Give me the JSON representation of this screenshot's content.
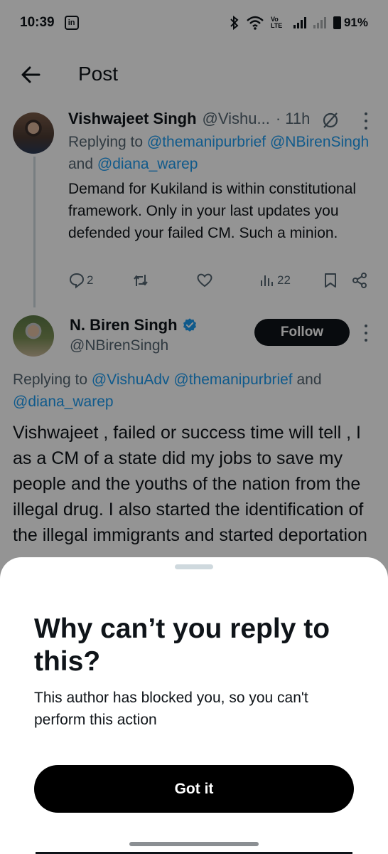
{
  "status_bar": {
    "time": "10:39",
    "app_badge": "in",
    "battery": "91%",
    "volte": "Vo LTE"
  },
  "header": {
    "title": "Post"
  },
  "tweet1": {
    "name": "Vishwajeet Singh",
    "handle": "@Vishu...",
    "time": "· 11h",
    "replying_prefix": "Replying to ",
    "replying_link1": "@themanipurbrief",
    "replying_link2": "@NBirenSingh",
    "replying_and": " and ",
    "replying_link3": "@diana_warep",
    "body": "Demand for Kukiland is within constitutional framework. Only in your last updates you defended your failed CM. Such a minion.",
    "replies": "2",
    "views": "22"
  },
  "tweet2": {
    "name": "N. Biren Singh",
    "handle": "@NBirenSingh",
    "follow_label": "Follow",
    "replying_prefix": "Replying to ",
    "replying_link1": "@VishuAdv",
    "replying_link2": "@themanipurbrief",
    "replying_and": " and ",
    "replying_link3": "@diana_warep",
    "body": "Vishwajeet , failed or success time will tell , I as a CM of a state did my jobs to save my people and the youths of the nation from the illegal drug. I also started the identification of the illegal immigrants and started deportation"
  },
  "sheet": {
    "title": "Why can’t you reply to this?",
    "text": "This author has blocked you, so you can't perform this action",
    "button_label": "Got it"
  },
  "colors": {
    "accent": "#1d9bf0",
    "text": "#0f1419",
    "muted": "#536471",
    "button": "#000000"
  }
}
